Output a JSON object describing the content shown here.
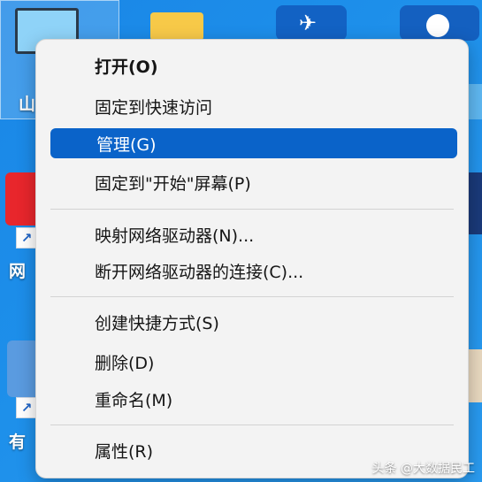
{
  "desktop": {
    "labels": {
      "this_pc_partial": "山",
      "network_partial": "网",
      "recycle_partial": "有"
    },
    "shortcut_arrow": "↗"
  },
  "context_menu": {
    "items": [
      {
        "label": "打开(O)",
        "bold": true
      },
      {
        "label": "固定到快速访问"
      },
      {
        "label": "管理(G)",
        "highlighted": true
      },
      {
        "label": "固定到\"开始\"屏幕(P)"
      },
      {
        "label": "映射网络驱动器(N)..."
      },
      {
        "label": "断开网络驱动器的连接(C)..."
      },
      {
        "label": "创建快捷方式(S)"
      },
      {
        "label": "删除(D)"
      },
      {
        "label": "重命名(M)"
      },
      {
        "label": "属性(R)"
      }
    ]
  },
  "watermark": "头条 @大数据民工",
  "colors": {
    "highlight": "#0a63c9",
    "desktop": "#1d8fea",
    "menu_bg": "#f3f3f3"
  }
}
